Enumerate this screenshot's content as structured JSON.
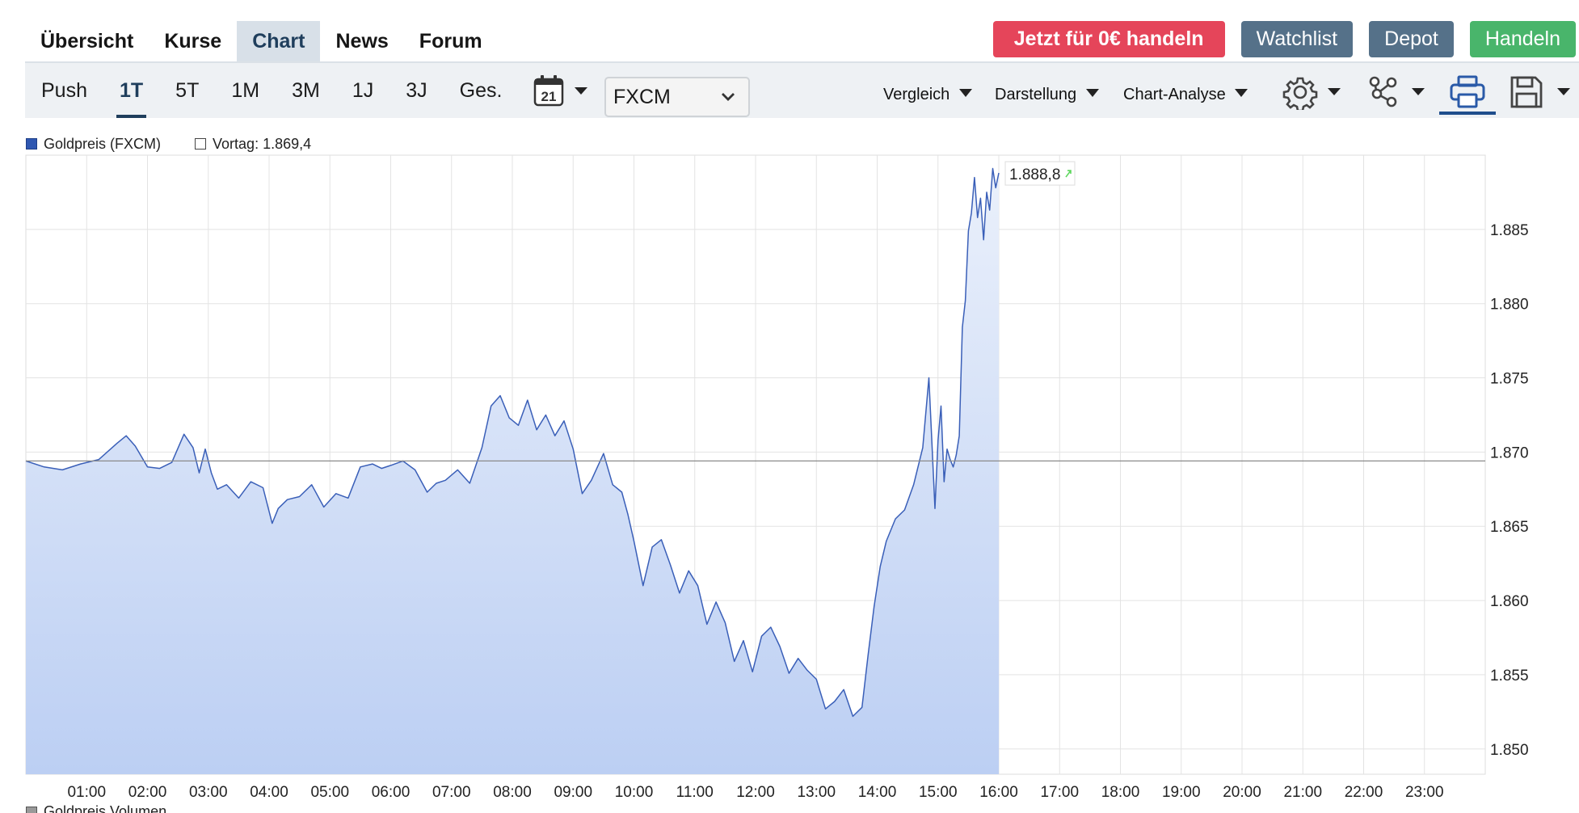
{
  "nav": {
    "tabs": [
      "Übersicht",
      "Kurse",
      "Chart",
      "News",
      "Forum"
    ],
    "active_tab": "Chart"
  },
  "actions": {
    "trade_free": "Jetzt für 0€ handeln",
    "watchlist": "Watchlist",
    "depot": "Depot",
    "handeln": "Handeln"
  },
  "toolbar": {
    "ranges": [
      "Push",
      "1T",
      "5T",
      "1M",
      "3M",
      "1J",
      "3J",
      "Ges."
    ],
    "active_range": "1T",
    "calendar_day": "21",
    "exchange": "FXCM",
    "menus": [
      "Vergleich",
      "Darstellung",
      "Chart-Analyse"
    ],
    "tools": [
      "gear-icon",
      "share-nodes-icon",
      "print-icon",
      "save-icon"
    ]
  },
  "legend": {
    "series": "Goldpreis (FXCM)",
    "previous": "Vortag: 1.869,4",
    "volume": "Goldpreis Volumen"
  },
  "colors": {
    "accent": "#1f3e5c",
    "line": "#3a5fb8",
    "fill_top": "#eaf0fb",
    "fill_bottom": "#bccff3",
    "red_button": "#e5455a",
    "slate_button": "#557189",
    "green_button": "#49b56b"
  },
  "chart_data": {
    "type": "area",
    "title": "",
    "xlabel": "",
    "ylabel": "",
    "last_value_label": "1.888,8",
    "reference_line": 1869.4,
    "ylim": [
      1848.3,
      1890.0
    ],
    "xlim": [
      0.0,
      24.0
    ],
    "yticks": [
      1850,
      1855,
      1860,
      1865,
      1870,
      1875,
      1880,
      1885
    ],
    "ytick_labels": [
      "1.850",
      "1.855",
      "1.860",
      "1.865",
      "1.870",
      "1.875",
      "1.880",
      "1.885"
    ],
    "xticks": [
      1,
      2,
      3,
      4,
      5,
      6,
      7,
      8,
      9,
      10,
      11,
      12,
      13,
      14,
      15,
      16,
      17,
      18,
      19,
      20,
      21,
      22,
      23
    ],
    "xtick_labels": [
      "01:00",
      "02:00",
      "03:00",
      "04:00",
      "05:00",
      "06:00",
      "07:00",
      "08:00",
      "09:00",
      "10:00",
      "11:00",
      "12:00",
      "13:00",
      "14:00",
      "15:00",
      "16:00",
      "17:00",
      "18:00",
      "19:00",
      "20:00",
      "21:00",
      "22:00",
      "23:00"
    ],
    "series": [
      {
        "x": [
          0.0,
          0.3,
          0.6,
          0.9,
          1.2,
          1.5,
          1.65,
          1.8,
          2.0,
          2.2,
          2.4,
          2.6,
          2.75,
          2.85,
          2.95,
          3.05,
          3.15,
          3.3,
          3.5,
          3.7,
          3.9,
          4.05,
          4.15,
          4.3,
          4.5,
          4.7,
          4.9,
          5.1,
          5.3,
          5.5,
          5.7,
          5.85,
          6.0,
          6.2,
          6.4,
          6.6,
          6.75,
          6.9,
          7.1,
          7.3,
          7.5,
          7.65,
          7.8,
          7.95,
          8.1,
          8.25,
          8.4,
          8.55,
          8.7,
          8.85,
          9.0,
          9.15,
          9.3,
          9.5,
          9.65,
          9.8,
          9.9,
          10.0,
          10.15,
          10.3,
          10.45,
          10.6,
          10.75,
          10.9,
          11.05,
          11.2,
          11.35,
          11.5,
          11.65,
          11.8,
          11.95,
          12.1,
          12.25,
          12.4,
          12.55,
          12.7,
          12.85,
          13.0,
          13.15,
          13.3,
          13.45,
          13.6,
          13.75,
          13.85,
          13.95,
          14.05,
          14.15,
          14.3,
          14.45,
          14.6,
          14.75,
          14.85,
          14.95,
          15.0,
          15.05,
          15.1,
          15.15,
          15.2,
          15.25,
          15.3,
          15.35,
          15.4,
          15.45,
          15.5,
          15.55,
          15.6,
          15.65,
          15.7,
          15.75,
          15.8,
          15.85,
          15.9,
          15.95,
          16.0
        ],
        "y": [
          1869.4,
          1869.0,
          1868.8,
          1869.2,
          1869.5,
          1870.6,
          1871.1,
          1870.4,
          1869.0,
          1868.9,
          1869.3,
          1871.2,
          1870.3,
          1868.6,
          1870.2,
          1868.6,
          1867.5,
          1867.8,
          1866.9,
          1868.0,
          1867.6,
          1865.2,
          1866.2,
          1866.8,
          1867.0,
          1867.8,
          1866.3,
          1867.2,
          1866.9,
          1869.0,
          1869.2,
          1868.9,
          1869.1,
          1869.4,
          1868.8,
          1867.3,
          1867.9,
          1868.1,
          1868.8,
          1867.9,
          1870.3,
          1873.1,
          1873.8,
          1872.3,
          1871.8,
          1873.5,
          1871.5,
          1872.5,
          1871.1,
          1872.1,
          1870.2,
          1867.2,
          1868.1,
          1869.9,
          1867.8,
          1867.3,
          1865.8,
          1864.0,
          1861.0,
          1863.6,
          1864.1,
          1862.4,
          1860.5,
          1862.0,
          1861.0,
          1858.4,
          1859.9,
          1858.5,
          1855.9,
          1857.3,
          1855.2,
          1857.6,
          1858.2,
          1856.9,
          1855.1,
          1856.1,
          1855.3,
          1854.7,
          1852.7,
          1853.2,
          1854.0,
          1852.2,
          1852.8,
          1856.3,
          1859.6,
          1862.3,
          1864.0,
          1865.5,
          1866.1,
          1867.8,
          1870.3,
          1875.0,
          1866.2,
          1870.8,
          1873.1,
          1868.0,
          1870.2,
          1869.5,
          1869.0,
          1869.8,
          1871.1,
          1878.4,
          1880.2,
          1884.9,
          1886.1,
          1888.5,
          1885.8,
          1887.1,
          1884.3,
          1887.5,
          1886.3,
          1889.1,
          1887.8,
          1888.8
        ]
      }
    ]
  }
}
